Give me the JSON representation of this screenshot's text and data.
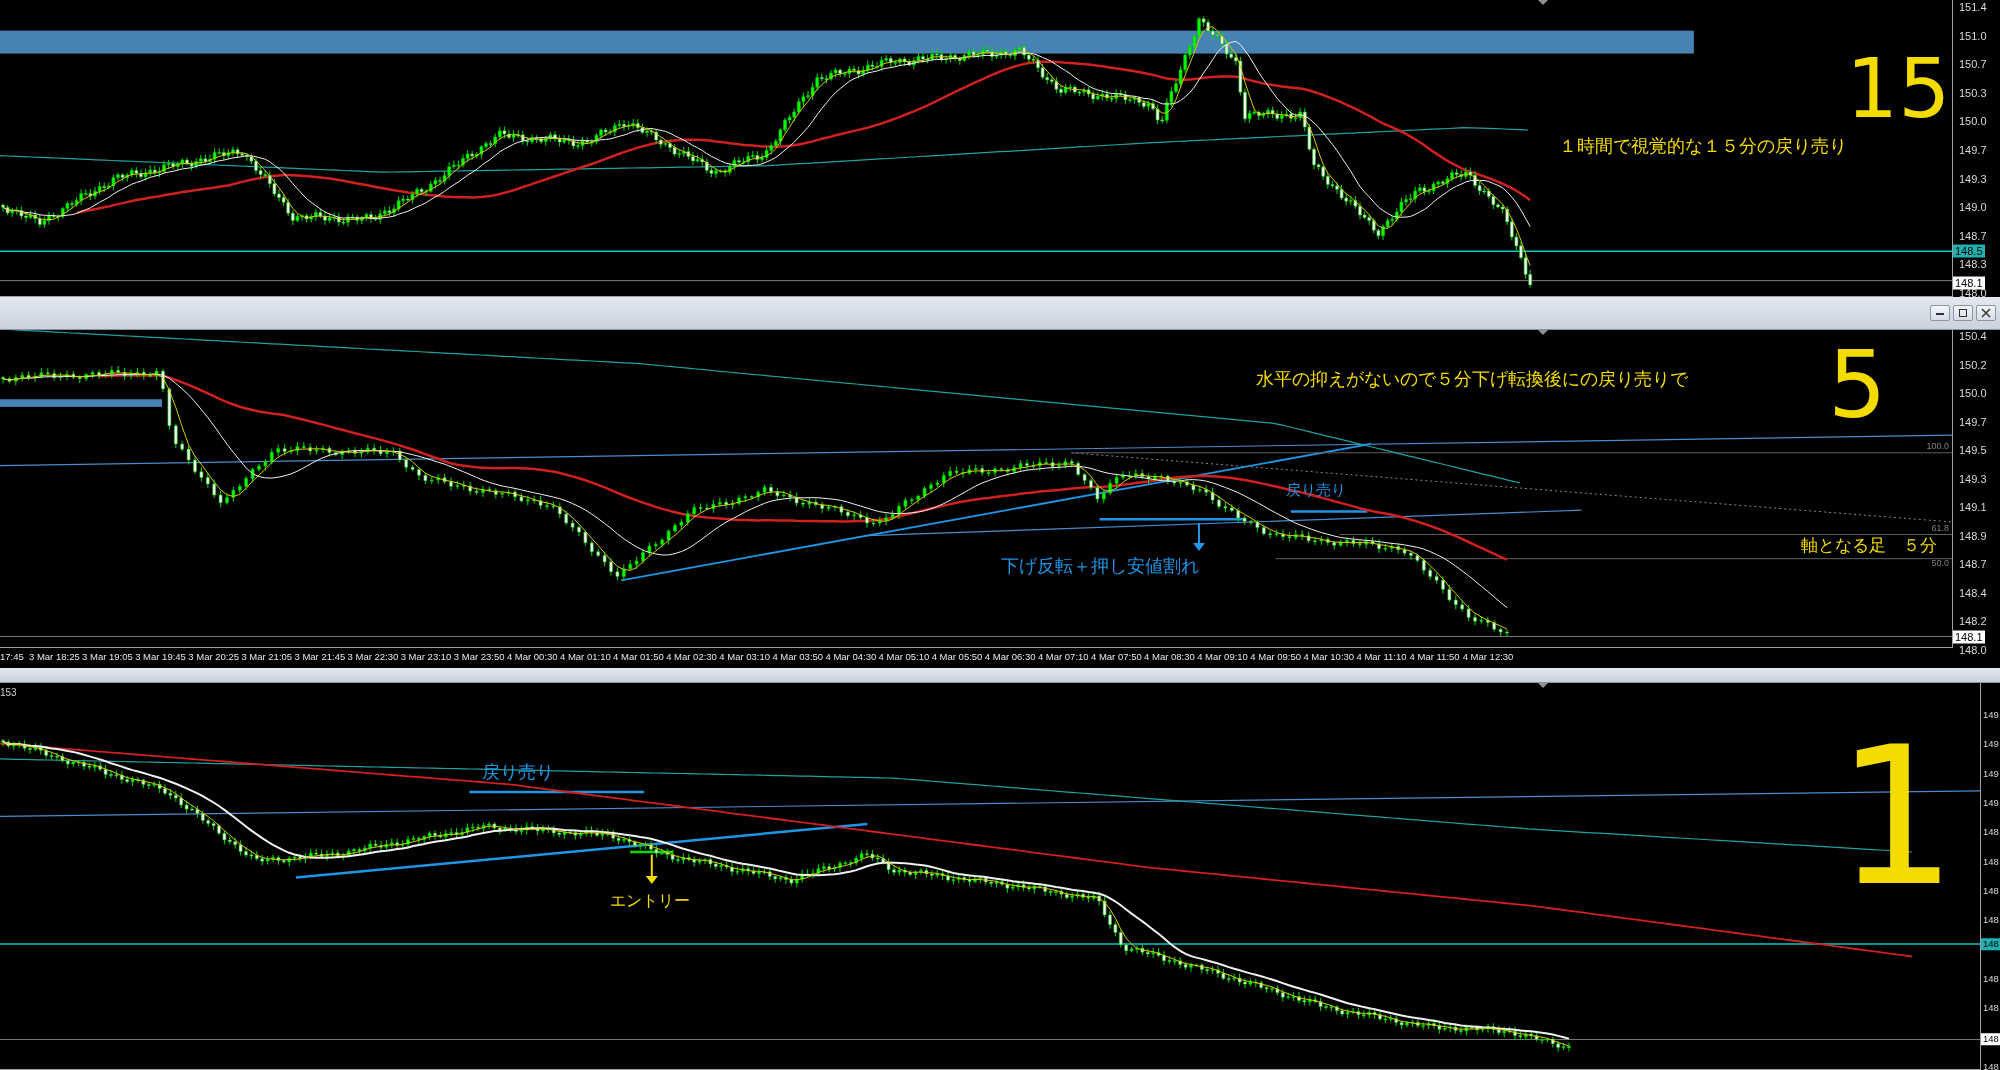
{
  "panes": [
    {
      "kind": "upper",
      "price_labels": [
        "151.4",
        "151.0",
        "150.7",
        "150.3",
        "150.0",
        "149.7",
        "149.3",
        "149.0",
        "148.7",
        "148.3",
        "148.0"
      ],
      "price_tags": [
        {
          "text": "148.5",
          "kind": "line"
        },
        {
          "text": "148.1",
          "kind": "bid"
        }
      ],
      "annotations": [
        {
          "text": "１時間で視覚的な１５分の戻り売り",
          "color": "#f5dc00"
        }
      ],
      "handwritten_label": "15"
    },
    {
      "kind": "middle",
      "price_labels": [
        "150.4",
        "150.2",
        "150.0",
        "149.7",
        "149.5",
        "149.3",
        "149.1",
        "148.9",
        "148.7",
        "148.4",
        "148.2",
        "148.0"
      ],
      "price_tags": [
        {
          "text": "148.1",
          "kind": "bid"
        }
      ],
      "fib_labels": [
        "100.0",
        "61.8",
        "50.0"
      ],
      "annotations": [
        {
          "text": "水平の抑えがないので５分下げ転換後にの戻り売りで",
          "color": "#f5dc00"
        },
        {
          "text": "戻り売り",
          "color": "#1e96e6"
        },
        {
          "text": "下げ反転＋押し安値割れ",
          "color": "#1e96e6"
        },
        {
          "text": "軸となる足　５分",
          "color": "#f5dc00"
        }
      ],
      "handwritten_label": "5",
      "time_labels": [
        "17:45",
        "3 Mar 18:25",
        "3 Mar 19:05",
        "3 Mar 19:45",
        "3 Mar 20:25",
        "3 Mar 21:05",
        "3 Mar 21:45",
        "3 Mar 22:30",
        "3 Mar 23:10",
        "3 Mar 23:50",
        "4 Mar 00:30",
        "4 Mar 01:10",
        "4 Mar 01:50",
        "4 Mar 02:30",
        "4 Mar 03:10",
        "4 Mar 03:50",
        "4 Mar 04:30",
        "4 Mar 05:10",
        "4 Mar 05:50",
        "4 Mar 06:30",
        "4 Mar 07:10",
        "4 Mar 07:50",
        "4 Mar 08:30",
        "4 Mar 09:10",
        "4 Mar 09:50",
        "4 Mar 10:30",
        "4 Mar 11:10",
        "4 Mar 11:50",
        "4 Mar 12:30"
      ]
    },
    {
      "kind": "lower",
      "pane_label": "153",
      "price_labels": [
        "149",
        "149",
        "149",
        "149",
        "148",
        "148",
        "148",
        "148",
        "148",
        "148",
        "148"
      ],
      "price_tags": [
        {
          "text": "148",
          "kind": "line"
        },
        {
          "text": "148",
          "kind": "bid"
        }
      ],
      "annotations": [
        {
          "text": "戻り売り",
          "color": "#1e96e6"
        },
        {
          "text": "エントリー",
          "color": "#f5dc00"
        }
      ],
      "handwritten_label": "1"
    }
  ]
}
